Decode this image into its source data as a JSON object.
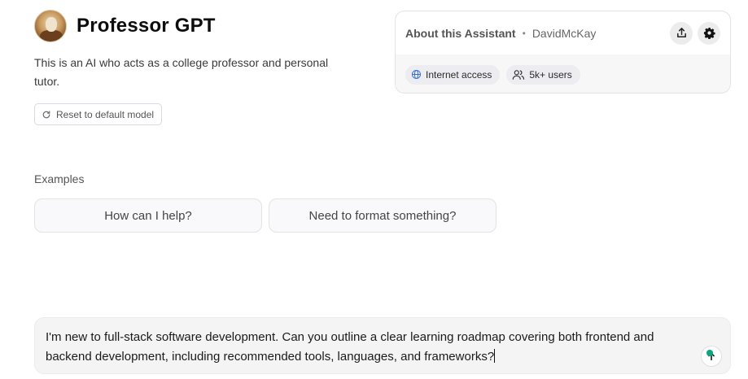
{
  "gpt": {
    "name": "Professor GPT",
    "description": "This is an AI who acts as a college professor and personal tutor.",
    "reset_label": "Reset to default model"
  },
  "about": {
    "title": "About this Assistant",
    "author": "DavidMcKay",
    "capability_chip": "Internet access",
    "users_chip": "5k+ users"
  },
  "examples": {
    "label": "Examples",
    "items": [
      "How can I help?",
      "Need to format something?"
    ]
  },
  "composer": {
    "text": "I'm new to full-stack software development. Can you outline a clear learning roadmap covering both frontend and backend development, including recommended tools, languages, and frameworks?"
  },
  "colors": {
    "accent": "#10a37f",
    "chip_bg": "#ececf1",
    "composer_bg": "#f4f4f4"
  },
  "icons": [
    "avatar-image",
    "refresh-icon",
    "share-icon",
    "gear-icon",
    "globe-icon",
    "users-icon",
    "send-arrow-icon"
  ]
}
